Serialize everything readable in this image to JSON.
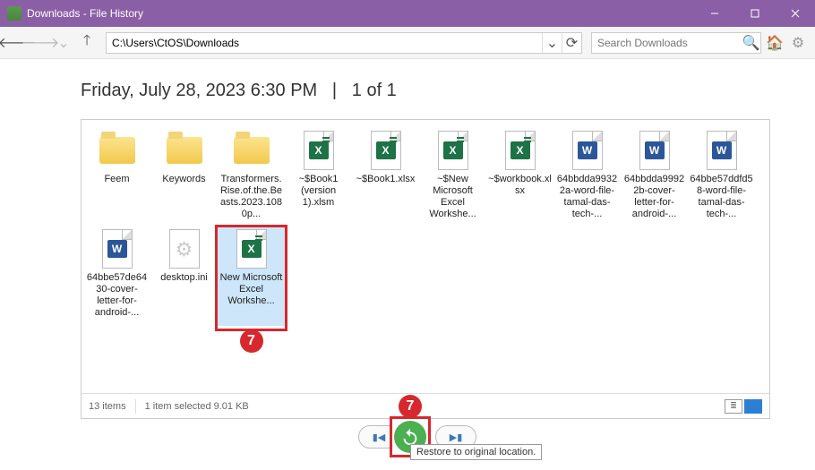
{
  "window": {
    "title": "Downloads - File History"
  },
  "nav": {
    "path": "C:\\Users\\CtOS\\Downloads",
    "search_placeholder": "Search Downloads"
  },
  "header": {
    "timestamp": "Friday, July 28, 2023 6:30 PM",
    "sep": "|",
    "pager": "1 of 1"
  },
  "items": [
    {
      "label": "Feem",
      "type": "folder"
    },
    {
      "label": "Keywords",
      "type": "folder"
    },
    {
      "label": "Transformers.Rise.of.the.Beasts.2023.1080p...",
      "type": "folder"
    },
    {
      "label": "~$Book1 (version 1).xlsm",
      "type": "excel"
    },
    {
      "label": "~$Book1.xlsx",
      "type": "excel"
    },
    {
      "label": "~$New Microsoft Excel Workshe...",
      "type": "excel"
    },
    {
      "label": "~$workbook.xlsx",
      "type": "excel"
    },
    {
      "label": "64bbdda99322a-word-file-tamal-das-tech-...",
      "type": "word"
    },
    {
      "label": "64bbdda99922b-cover-letter-for-android-...",
      "type": "word"
    },
    {
      "label": "64bbe57ddfd58-word-file-tamal-das-tech-...",
      "type": "word"
    },
    {
      "label": "64bbe57de6430-cover-letter-for-android-...",
      "type": "word"
    },
    {
      "label": "desktop.ini",
      "type": "ini"
    },
    {
      "label": "New Microsoft Excel Workshe...",
      "type": "excel",
      "selected": true,
      "boxed": true
    }
  ],
  "status": {
    "count": "13 items",
    "selection": "1 item selected  9.01 KB"
  },
  "callout": {
    "label": "7"
  },
  "tooltip": {
    "text": "Restore to original location."
  }
}
